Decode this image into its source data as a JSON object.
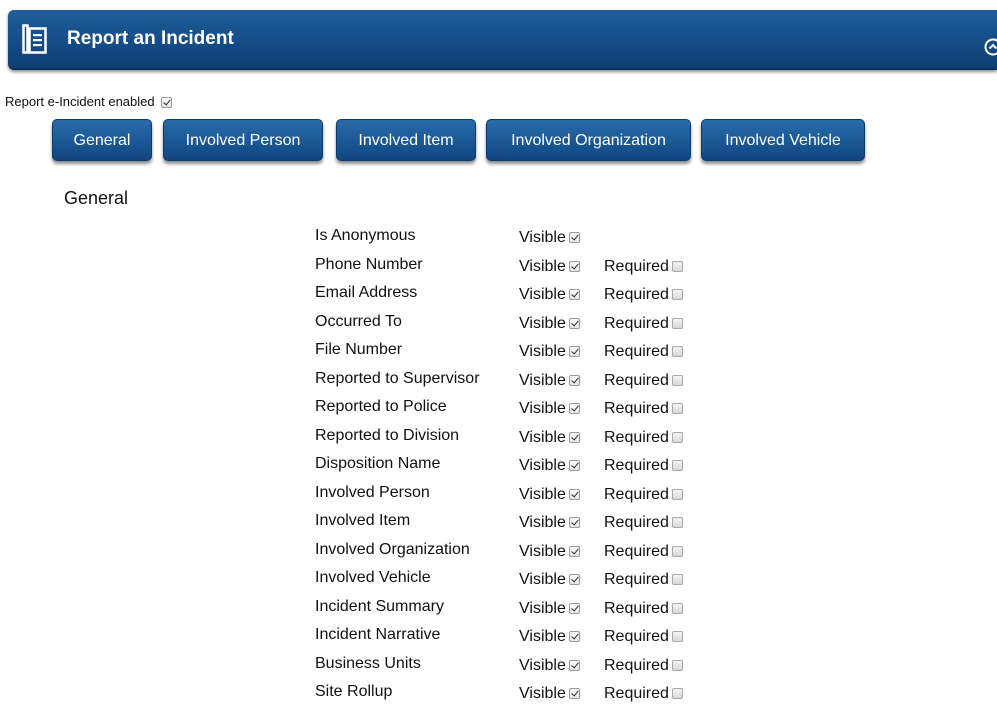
{
  "header": {
    "title": "Report an Incident",
    "icon": "document-icon",
    "collapse_icon": "chevron-up-circle-icon"
  },
  "enabled": {
    "label": "Report e-Incident enabled",
    "checked": true
  },
  "tabs": [
    {
      "label": "General"
    },
    {
      "label": "Involved Person"
    },
    {
      "label": "Involved Item"
    },
    {
      "label": "Involved Organization"
    },
    {
      "label": "Involved Vehicle"
    }
  ],
  "section_title": "General",
  "visible_label": "Visible",
  "required_label": "Required",
  "fields": [
    {
      "label": "Is Anonymous",
      "visible": true,
      "required": null
    },
    {
      "label": "Phone Number",
      "visible": true,
      "required": false
    },
    {
      "label": "Email Address",
      "visible": true,
      "required": false
    },
    {
      "label": "Occurred To",
      "visible": true,
      "required": false
    },
    {
      "label": "File Number",
      "visible": true,
      "required": false
    },
    {
      "label": "Reported to Supervisor",
      "visible": true,
      "required": false
    },
    {
      "label": "Reported to Police",
      "visible": true,
      "required": false
    },
    {
      "label": "Reported to Division",
      "visible": true,
      "required": false
    },
    {
      "label": "Disposition Name",
      "visible": true,
      "required": false
    },
    {
      "label": "Involved Person",
      "visible": true,
      "required": false
    },
    {
      "label": "Involved Item",
      "visible": true,
      "required": false
    },
    {
      "label": "Involved Organization",
      "visible": true,
      "required": false
    },
    {
      "label": "Involved Vehicle",
      "visible": true,
      "required": false
    },
    {
      "label": "Incident Summary",
      "visible": true,
      "required": false
    },
    {
      "label": "Incident Narrative",
      "visible": true,
      "required": false
    },
    {
      "label": "Business Units",
      "visible": true,
      "required": false
    },
    {
      "label": "Site Rollup",
      "visible": true,
      "required": false
    }
  ]
}
